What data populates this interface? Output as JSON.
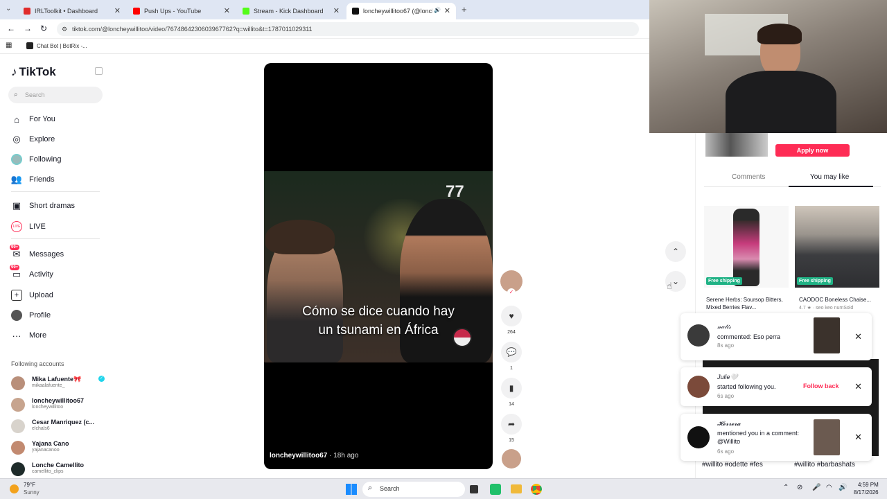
{
  "browser": {
    "tabs": [
      {
        "label": "IRLToolkit • Dashboard",
        "color": "#e02b2b"
      },
      {
        "label": "Push Ups - YouTube",
        "color": "#ff0000"
      },
      {
        "label": "Stream - Kick Dashboard",
        "color": "#53fc18"
      },
      {
        "label": "loncheywillitoo67 (@lonche",
        "color": "#111111"
      }
    ],
    "new_tab": "+",
    "url": "tiktok.com/@loncheywillitoo/video/7674864230603967762?q=willito&t=1787011029311",
    "bookmark": "Chat Bot | BotRix -..."
  },
  "sidebar": {
    "brand": "TikTok",
    "search_placeholder": "Search",
    "nav": [
      {
        "label": "For You",
        "icon": "home-icon"
      },
      {
        "label": "Explore",
        "icon": "compass-icon"
      },
      {
        "label": "Following",
        "icon": "following-avatar-icon"
      },
      {
        "label": "Friends",
        "icon": "friends-icon"
      },
      {
        "label": "Short dramas",
        "icon": "film-icon"
      },
      {
        "label": "LIVE",
        "icon": "live-icon"
      },
      {
        "label": "Messages",
        "icon": "messages-icon",
        "badge": "99+"
      },
      {
        "label": "Activity",
        "icon": "activity-icon",
        "badge": "99+"
      },
      {
        "label": "Upload",
        "icon": "upload-icon"
      },
      {
        "label": "Profile",
        "icon": "profile-icon"
      },
      {
        "label": "More",
        "icon": "more-icon"
      }
    ],
    "following_title": "Following accounts",
    "accounts": [
      {
        "name": "Mika Lafuente🎀",
        "handle": "mikaalafuente_"
      },
      {
        "name": "loncheywillitoo67",
        "handle": "loncheywillitoo"
      },
      {
        "name": "Cesar Manriquez (c...",
        "handle": "elchals6"
      },
      {
        "name": "Yajana Cano",
        "handle": "yajanacanoo"
      },
      {
        "name": "Lonche Camellito",
        "handle": "camellito_clips"
      }
    ]
  },
  "video": {
    "caption_line1": "Cómo se dice cuando hay",
    "caption_line2": "un tsunami en África",
    "author": "loncheywillitoo67",
    "age": " · 18h ago",
    "cap_number": "77"
  },
  "actions": {
    "likes": "264",
    "comments": "1",
    "saves": "14",
    "shares": "15"
  },
  "right_panel": {
    "apply_label": "Apply now",
    "tabs": [
      "Comments",
      "You may like"
    ],
    "products": [
      {
        "badge": "Free shipping",
        "title": "Serene Herbs: Soursop Bitters, Mixed Berries Flav..."
      },
      {
        "badge": "Free shipping",
        "title": "CAODOC Boneless Chaise...",
        "rating": "4.7 ★ · seo keo numSold"
      }
    ],
    "tags": [
      "#willito #odette #fes",
      "#willito #barbashats"
    ]
  },
  "notifications": [
    {
      "name": "𝓃𝒶𝓉𝒾𝓈",
      "text": "commented: Eso perra",
      "time": "8s ago"
    },
    {
      "name": "Julie🤍",
      "text": "started following you.",
      "time": "6s ago",
      "action": "Follow back"
    },
    {
      "name": "𝓗𝓮𝓻𝓻𝓮𝓻𝓪",
      "text": "mentioned you in a comment: @Willito",
      "time": "6s ago"
    }
  ],
  "taskbar": {
    "temp": "79°F",
    "weather": "Sunny",
    "search": "Search",
    "time": "4:59 PM",
    "date": "8/17/2026"
  },
  "colors": {
    "accent": "#fe2c55",
    "shipping": "#20b285"
  }
}
